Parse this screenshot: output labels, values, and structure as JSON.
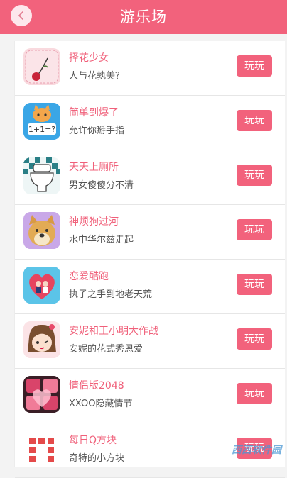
{
  "header": {
    "title": "游乐场"
  },
  "play_label": "玩玩",
  "games": [
    {
      "name": "择花少女",
      "desc": "人与花孰美？",
      "icon": "rose-icon"
    },
    {
      "name": "简单到爆了",
      "desc": "允许你掰手指",
      "icon": "cat-math-icon"
    },
    {
      "name": "天天上厕所",
      "desc": "男女傻傻分不清",
      "icon": "toilet-icon"
    },
    {
      "name": "神烦狗过河",
      "desc": "水中华尔兹走起",
      "icon": "doge-icon"
    },
    {
      "name": "恋爱酷跑",
      "desc": "执子之手到地老天荒",
      "icon": "heart-couple-icon"
    },
    {
      "name": "安妮和王小明大作战",
      "desc": "安妮的花式秀恩爱",
      "icon": "anime-girl-icon"
    },
    {
      "name": "情侣版2048",
      "desc": "XXOO隐藏情节",
      "icon": "heart-2048-icon"
    },
    {
      "name": "每日Q方块",
      "desc": "奇特的小方块",
      "icon": "q-block-icon"
    }
  ],
  "watermark": "西西软件园"
}
